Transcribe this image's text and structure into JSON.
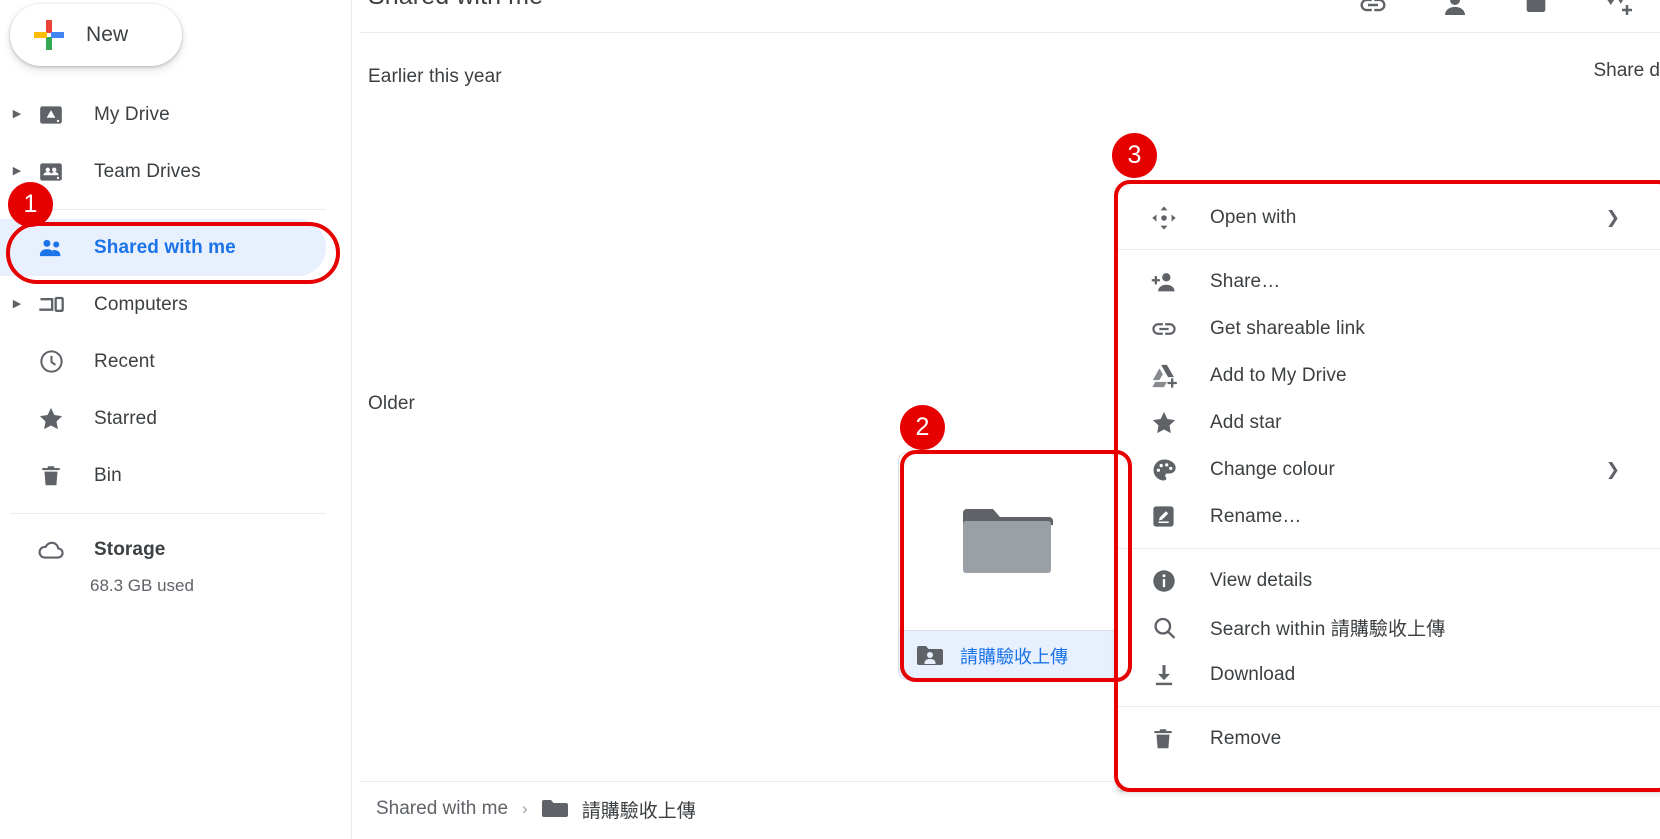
{
  "sidebar": {
    "new_button": {
      "label": "New",
      "icon": "plus-icon"
    },
    "items": [
      {
        "label": "My Drive",
        "icon": "drive-icon",
        "expandable": true,
        "selected": false
      },
      {
        "label": "Team Drives",
        "icon": "team-icon",
        "expandable": true,
        "selected": false
      },
      {
        "label": "Shared with me",
        "icon": "people-icon",
        "expandable": false,
        "selected": true
      },
      {
        "label": "Computers",
        "icon": "computer-icon",
        "expandable": true,
        "selected": false
      },
      {
        "label": "Recent",
        "icon": "clock-icon",
        "expandable": false,
        "selected": false
      },
      {
        "label": "Starred",
        "icon": "star-icon",
        "expandable": false,
        "selected": false
      },
      {
        "label": "Bin",
        "icon": "trash-icon",
        "expandable": false,
        "selected": false
      }
    ],
    "storage": {
      "icon": "cloud-icon",
      "title": "Storage",
      "used": "68.3 GB used"
    }
  },
  "header": {
    "title": "Shared with me",
    "icons": [
      "link-icon",
      "person-icon",
      "grid-view-icon",
      "sort-icon"
    ]
  },
  "main": {
    "section_earlier": "Earlier this year",
    "section_older": "Older",
    "share_date_column": "Share d",
    "folder": {
      "name": "請購驗收上傳",
      "icon": "shared-folder-icon",
      "selected": true
    }
  },
  "breadcrumb": {
    "root": "Shared with me",
    "separator": "›",
    "current": "請購驗收上傳",
    "icon": "folder-icon"
  },
  "context_menu": {
    "groups": [
      [
        {
          "label": "Open with",
          "icon": "move-icon",
          "submenu": true
        }
      ],
      [
        {
          "label": "Share…",
          "icon": "person-add-icon",
          "submenu": false
        },
        {
          "label": "Get shareable link",
          "icon": "link-icon",
          "submenu": false
        },
        {
          "label": "Add to My Drive",
          "icon": "drive-add-icon",
          "submenu": false
        },
        {
          "label": "Add star",
          "icon": "star-icon",
          "submenu": false
        },
        {
          "label": "Change colour",
          "icon": "palette-icon",
          "submenu": true
        },
        {
          "label": "Rename…",
          "icon": "pencil-icon",
          "submenu": false
        }
      ],
      [
        {
          "label": "View details",
          "icon": "info-icon",
          "submenu": false
        },
        {
          "label": "Search within 請購驗收上傳",
          "icon": "search-icon",
          "submenu": false
        },
        {
          "label": "Download",
          "icon": "download-icon",
          "submenu": false
        }
      ],
      [
        {
          "label": "Remove",
          "icon": "trash-icon",
          "submenu": false
        }
      ]
    ]
  },
  "annotations": {
    "accent_color": "#e60000",
    "markers": [
      {
        "number": "1",
        "target": "sidebar-item-shared-with-me"
      },
      {
        "number": "2",
        "target": "folder-card"
      },
      {
        "number": "3",
        "target": "context-menu"
      }
    ]
  }
}
